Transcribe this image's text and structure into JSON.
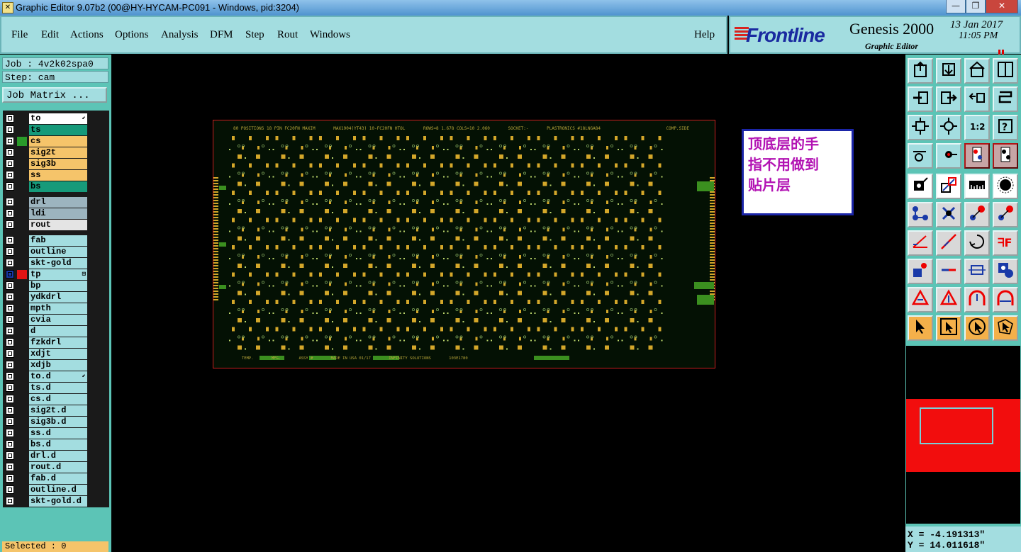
{
  "window": {
    "title": "Graphic Editor 9.07b2 (00@HY-HYCAM-PC091 - Windows, pid:3204)",
    "min_glyph": "—",
    "max_glyph": "❐",
    "close_glyph": "✕"
  },
  "menu": {
    "items": [
      "File",
      "Edit",
      "Actions",
      "Options",
      "Analysis",
      "DFM",
      "Step",
      "Rout",
      "Windows"
    ],
    "help": "Help"
  },
  "brand": {
    "logo": "Frontline",
    "product": "Genesis 2000",
    "subtitle": "Graphic Editor",
    "date": "13 Jan 2017",
    "time": "11:05 PM"
  },
  "job": {
    "job_label": "Job : 4v2k02spa0",
    "step_label": "Step: cam",
    "job_matrix_button": "Job Matrix ..."
  },
  "layers": [
    {
      "name": "to",
      "swatch": "#1a1a1a",
      "bg": "#ffffff",
      "mark": "⬋"
    },
    {
      "name": "ts",
      "swatch": "#1a1a1a",
      "bg": "#169a7a",
      "mark": ""
    },
    {
      "name": "cs",
      "swatch": "#2a9a2a",
      "bg": "#f5c46a",
      "mark": ""
    },
    {
      "name": "sig2t",
      "swatch": "#1a1a1a",
      "bg": "#f5c46a",
      "mark": ""
    },
    {
      "name": "sig3b",
      "swatch": "#1a1a1a",
      "bg": "#f5c46a",
      "mark": ""
    },
    {
      "name": "ss",
      "swatch": "#1a1a1a",
      "bg": "#f5c46a",
      "mark": ""
    },
    {
      "name": "bs",
      "swatch": "#1a1a1a",
      "bg": "#169a7a",
      "mark": ""
    },
    {
      "name": "drl",
      "swatch": "#1a1a1a",
      "bg": "#9cb4bf",
      "mark": ""
    },
    {
      "name": "ldi",
      "swatch": "#1a1a1a",
      "bg": "#9cb4bf",
      "mark": ""
    },
    {
      "name": "rout",
      "swatch": "#1a1a1a",
      "bg": "#e4e4e4",
      "mark": ""
    },
    {
      "name": "fab",
      "swatch": "#1a1a1a",
      "bg": "#a3dde0",
      "mark": ""
    },
    {
      "name": "outline",
      "swatch": "#1a1a1a",
      "bg": "#a3dde0",
      "mark": ""
    },
    {
      "name": "skt-gold",
      "swatch": "#1a1a1a",
      "bg": "#a3dde0",
      "mark": ""
    },
    {
      "name": "tp",
      "swatch": "#e01414",
      "bg": "#a3dde0",
      "mark": "⊞",
      "selected": true
    },
    {
      "name": "bp",
      "swatch": "#1a1a1a",
      "bg": "#a3dde0",
      "mark": ""
    },
    {
      "name": "ydkdrl",
      "swatch": "#1a1a1a",
      "bg": "#a3dde0",
      "mark": ""
    },
    {
      "name": "mpth",
      "swatch": "#1a1a1a",
      "bg": "#a3dde0",
      "mark": ""
    },
    {
      "name": "cvia",
      "swatch": "#1a1a1a",
      "bg": "#a3dde0",
      "mark": ""
    },
    {
      "name": "d",
      "swatch": "#1a1a1a",
      "bg": "#a3dde0",
      "mark": ""
    },
    {
      "name": "fzkdrl",
      "swatch": "#1a1a1a",
      "bg": "#a3dde0",
      "mark": ""
    },
    {
      "name": "xdjt",
      "swatch": "#1a1a1a",
      "bg": "#a3dde0",
      "mark": ""
    },
    {
      "name": "xdjb",
      "swatch": "#1a1a1a",
      "bg": "#a3dde0",
      "mark": ""
    },
    {
      "name": "to.d",
      "swatch": "#1a1a1a",
      "bg": "#a3dde0",
      "mark": "⬋"
    },
    {
      "name": "ts.d",
      "swatch": "#1a1a1a",
      "bg": "#a3dde0",
      "mark": ""
    },
    {
      "name": "cs.d",
      "swatch": "#1a1a1a",
      "bg": "#a3dde0",
      "mark": ""
    },
    {
      "name": "sig2t.d",
      "swatch": "#1a1a1a",
      "bg": "#a3dde0",
      "mark": ""
    },
    {
      "name": "sig3b.d",
      "swatch": "#1a1a1a",
      "bg": "#a3dde0",
      "mark": ""
    },
    {
      "name": "ss.d",
      "swatch": "#1a1a1a",
      "bg": "#a3dde0",
      "mark": ""
    },
    {
      "name": "bs.d",
      "swatch": "#1a1a1a",
      "bg": "#a3dde0",
      "mark": ""
    },
    {
      "name": "drl.d",
      "swatch": "#1a1a1a",
      "bg": "#a3dde0",
      "mark": ""
    },
    {
      "name": "rout.d",
      "swatch": "#1a1a1a",
      "bg": "#a3dde0",
      "mark": ""
    },
    {
      "name": "fab.d",
      "swatch": "#1a1a1a",
      "bg": "#a3dde0",
      "mark": ""
    },
    {
      "name": "outline.d",
      "swatch": "#1a1a1a",
      "bg": "#a3dde0",
      "mark": ""
    },
    {
      "name": "skt-gold.d",
      "swatch": "#1a1a1a",
      "bg": "#a3dde0",
      "mark": ""
    }
  ],
  "status": {
    "selected": "Selected : 0"
  },
  "board": {
    "header_texts": [
      "80 POSITIONS 18 PIN FC20FN MAXIM",
      "MAX1904(YT43) 10-FC20FN HTOL",
      "ROWS=8 1.678 COLS=10 2.060",
      "SOCKET:-",
      "PLASTRONICS #18LNGA84"
    ],
    "comp_side": "COMP.SIDE",
    "footer_texts": [
      "TEMP.",
      "MFG.",
      "ASSY #",
      "MADE IN USA 01/17",
      "INFINITY SOLUTIONS",
      "103E1780"
    ],
    "rows": 8,
    "cols": 10
  },
  "annotation": {
    "lines": [
      "顶底层的手",
      "指不用做到",
      "贴片层"
    ]
  },
  "toolbar": {
    "buttons": [
      {
        "icon": "open-job-icon",
        "style": "cyan"
      },
      {
        "icon": "save-icon",
        "style": "cyan"
      },
      {
        "icon": "home-icon",
        "style": "cyan"
      },
      {
        "icon": "window-split-icon",
        "style": "cyan"
      },
      {
        "icon": "import-icon",
        "style": "cyan"
      },
      {
        "icon": "export-icon",
        "style": "cyan"
      },
      {
        "icon": "undo-icon",
        "style": "cyan"
      },
      {
        "icon": "redo-icon",
        "style": "cyan"
      },
      {
        "icon": "zoom-fit-icon",
        "style": "cyan"
      },
      {
        "icon": "zoom-center-icon",
        "style": "cyan"
      },
      {
        "icon": "scale-1-2-icon",
        "style": "cyan"
      },
      {
        "icon": "help-icon",
        "style": "cyan"
      },
      {
        "icon": "measure-icon",
        "style": "cyan"
      },
      {
        "icon": "probe-icon",
        "style": "cyan"
      },
      {
        "icon": "layer-display-icon",
        "style": "redb"
      },
      {
        "icon": "layer-display-alt-icon",
        "style": "redb"
      },
      {
        "icon": "pad-add-icon",
        "style": "white"
      },
      {
        "icon": "line-add-icon",
        "style": "white"
      },
      {
        "icon": "ruler-icon",
        "style": "white"
      },
      {
        "icon": "round-pad-icon",
        "style": "white"
      },
      {
        "icon": "connect-icon",
        "style": "gray"
      },
      {
        "icon": "cross-icon",
        "style": "gray"
      },
      {
        "icon": "move-pad-icon",
        "style": "gray"
      },
      {
        "icon": "move-pad-alt-icon",
        "style": "gray"
      },
      {
        "icon": "angle-icon",
        "style": "gray"
      },
      {
        "icon": "diagonal-icon",
        "style": "gray"
      },
      {
        "icon": "rotate-icon",
        "style": "gray"
      },
      {
        "icon": "mirror-icon",
        "style": "gray"
      },
      {
        "icon": "resize-pad-icon",
        "style": "gray"
      },
      {
        "icon": "line-edit-icon",
        "style": "gray"
      },
      {
        "icon": "center-icon",
        "style": "gray"
      },
      {
        "icon": "group-icon",
        "style": "gray"
      },
      {
        "icon": "triangle-icon",
        "style": "gray"
      },
      {
        "icon": "triangle-up-icon",
        "style": "gray"
      },
      {
        "icon": "arc-up-icon",
        "style": "gray"
      },
      {
        "icon": "arc-flat-icon",
        "style": "gray"
      },
      {
        "icon": "select-pointer-icon",
        "style": "orange"
      },
      {
        "icon": "select-box-icon",
        "style": "orange"
      },
      {
        "icon": "select-circle-icon",
        "style": "orange"
      },
      {
        "icon": "select-polygon-icon",
        "style": "orange"
      }
    ]
  },
  "coords": {
    "x": "X = -4.191313\"",
    "y": "Y = 14.011618\""
  }
}
